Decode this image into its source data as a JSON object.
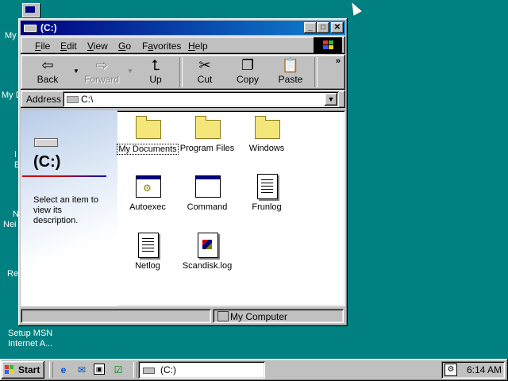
{
  "desktop": {
    "labels": [
      "My",
      "My D",
      "I",
      "E",
      "N",
      "Nei",
      "Re",
      "Setup MSN",
      "Internet A..."
    ]
  },
  "window": {
    "title": "(C:)",
    "title_buttons": [
      "_",
      "□",
      "✕"
    ],
    "menu": [
      "File",
      "Edit",
      "View",
      "Go",
      "Favorites",
      "Help"
    ],
    "menu_hotkeys": [
      "F",
      "E",
      "V",
      "G",
      "a",
      "H"
    ],
    "toolbar": {
      "back": "Back",
      "forward": "Forward",
      "up": "Up",
      "cut": "Cut",
      "copy": "Copy",
      "paste": "Paste",
      "more": "»"
    },
    "address": {
      "label": "Address",
      "value": "C:\\"
    },
    "info_pane": {
      "title": "(C:)",
      "description": "Select an item to view its description."
    },
    "files": [
      {
        "name": "My Documents",
        "icon": "folder-open-icon"
      },
      {
        "name": "Program Files",
        "icon": "folder-icon"
      },
      {
        "name": "Windows",
        "icon": "folder-icon"
      },
      {
        "name": "Autoexec",
        "icon": "batch-file-icon"
      },
      {
        "name": "Command",
        "icon": "program-icon"
      },
      {
        "name": "Frunlog",
        "icon": "text-file-icon"
      },
      {
        "name": "Netlog",
        "icon": "text-file-icon"
      },
      {
        "name": "Scandisk.log",
        "icon": "log-file-icon"
      }
    ],
    "selected_file": "My Documents",
    "status": {
      "right": "My Computer"
    }
  },
  "taskbar": {
    "start": "Start",
    "task": "(C:)",
    "clock": "6:14 AM"
  },
  "colors": {
    "desktop": "#008080",
    "title_active": "#000080",
    "face": "#c0c0c0"
  }
}
